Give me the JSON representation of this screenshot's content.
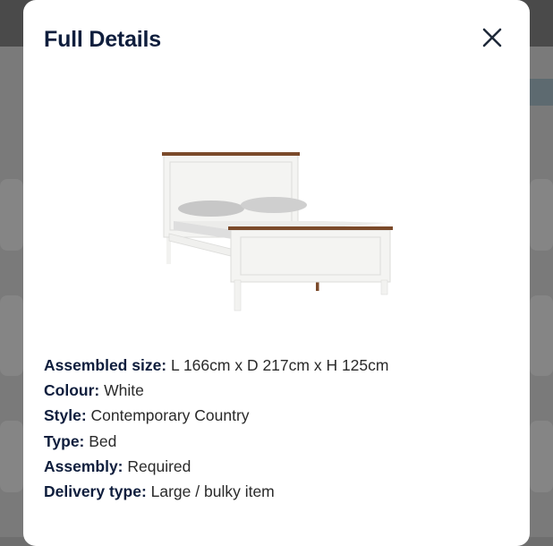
{
  "modal": {
    "title": "Full Details",
    "close_icon": "close-icon",
    "image_alt": "White bed with wooden top rail"
  },
  "specs": [
    {
      "label": "Assembled size:",
      "value": " L 166cm x D 217cm x H 125cm"
    },
    {
      "label": "Colour:",
      "value": " White"
    },
    {
      "label": "Style:",
      "value": " Contemporary Country"
    },
    {
      "label": "Type:",
      "value": " Bed"
    },
    {
      "label": "Assembly:",
      "value": " Required"
    },
    {
      "label": "Delivery type:",
      "value": " Large / bulky item"
    }
  ],
  "colors": {
    "overlay": "#7a7a7a",
    "title": "#0f1e3d",
    "text": "#2a2a2a",
    "wood": "#7b4a2a"
  }
}
